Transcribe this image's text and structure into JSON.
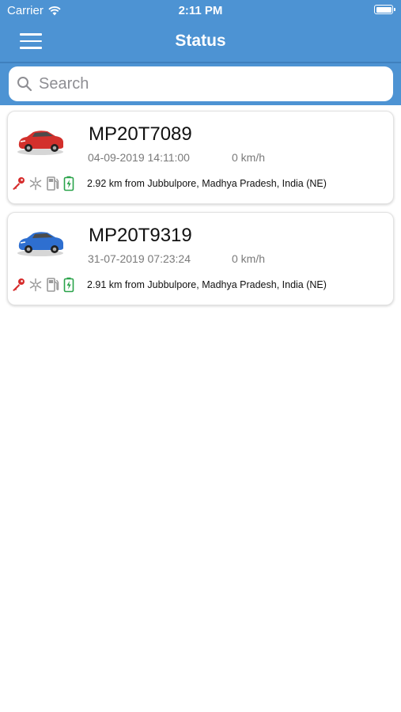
{
  "status_bar": {
    "carrier": "Carrier",
    "time": "2:11 PM"
  },
  "nav": {
    "title": "Status"
  },
  "search": {
    "placeholder": "Search"
  },
  "vehicles": [
    {
      "plate": "MP20T7089",
      "datetime": "04-09-2019 14:11:00",
      "speed": "0 km/h",
      "location": "2.92 km from Jubbulpore, Madhya Pradesh, India (NE)",
      "car_color": "#d3302c",
      "icons": [
        "ignition-key-icon",
        "ac-snowflake-icon",
        "fuel-pump-icon",
        "battery-charging-icon"
      ]
    },
    {
      "plate": "MP20T9319",
      "datetime": "31-07-2019 07:23:24",
      "speed": "0 km/h",
      "location": "2.91 km from Jubbulpore, Madhya Pradesh, India (NE)",
      "car_color": "#2e6fd0",
      "icons": [
        "ignition-key-icon",
        "ac-snowflake-icon",
        "fuel-pump-icon",
        "battery-charging-icon"
      ]
    }
  ],
  "colors": {
    "header": "#4d93d3",
    "key_icon": "#d62b2b",
    "battery_icon": "#2aa34a",
    "muted_icon": "#9a9a9a"
  }
}
